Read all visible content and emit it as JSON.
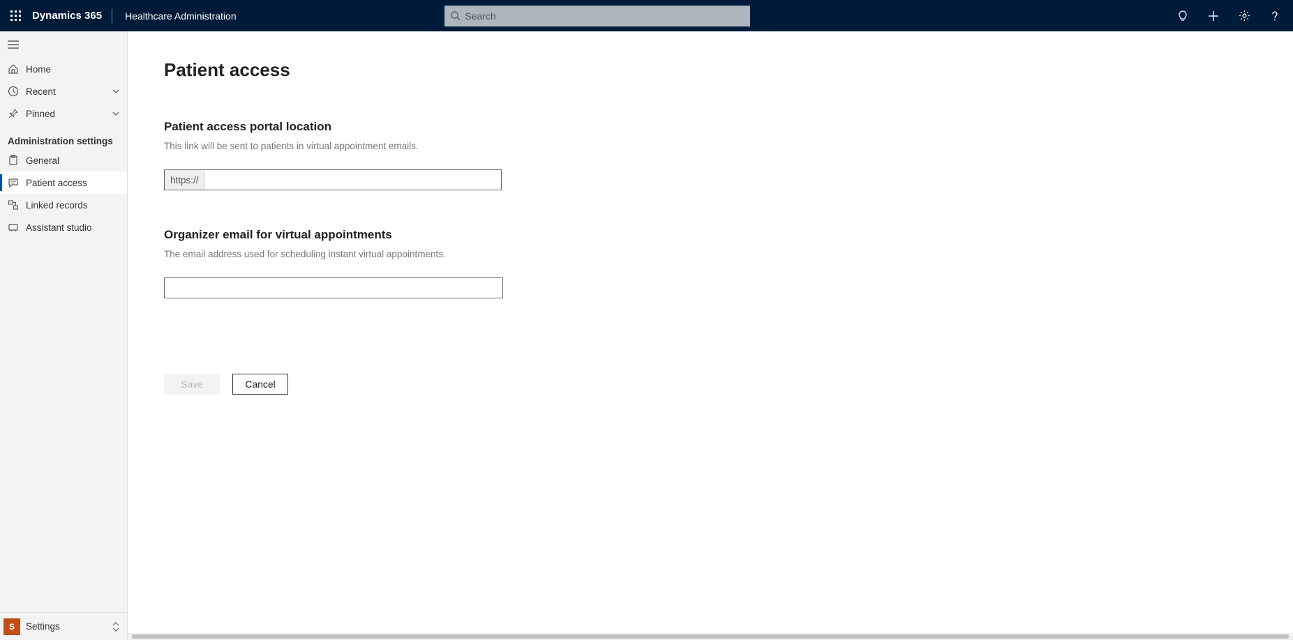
{
  "header": {
    "app_name": "Dynamics 365",
    "module_name": "Healthcare Administration",
    "search_placeholder": "Search"
  },
  "sidebar": {
    "items_top": [
      {
        "icon": "home",
        "label": "Home",
        "chevron": false
      },
      {
        "icon": "clock",
        "label": "Recent",
        "chevron": true
      },
      {
        "icon": "pin",
        "label": "Pinned",
        "chevron": true
      }
    ],
    "section_title": "Administration settings",
    "items_admin": [
      {
        "icon": "clipboard",
        "label": "General",
        "active": false
      },
      {
        "icon": "chat",
        "label": "Patient access",
        "active": true
      },
      {
        "icon": "linked",
        "label": "Linked records",
        "active": false
      },
      {
        "icon": "assistant",
        "label": "Assistant studio",
        "active": false
      }
    ],
    "footer": {
      "letter": "S",
      "label": "Settings"
    }
  },
  "main": {
    "page_title": "Patient access",
    "section1": {
      "title": "Patient access portal location",
      "desc": "This link will be sent to patients in virtual appointment emails.",
      "url_prefix": "https://",
      "url_value": ""
    },
    "section2": {
      "title": "Organizer email for virtual appointments",
      "desc": "The email address used for scheduling instant virtual appointments.",
      "value": ""
    },
    "buttons": {
      "save": "Save",
      "cancel": "Cancel"
    }
  }
}
